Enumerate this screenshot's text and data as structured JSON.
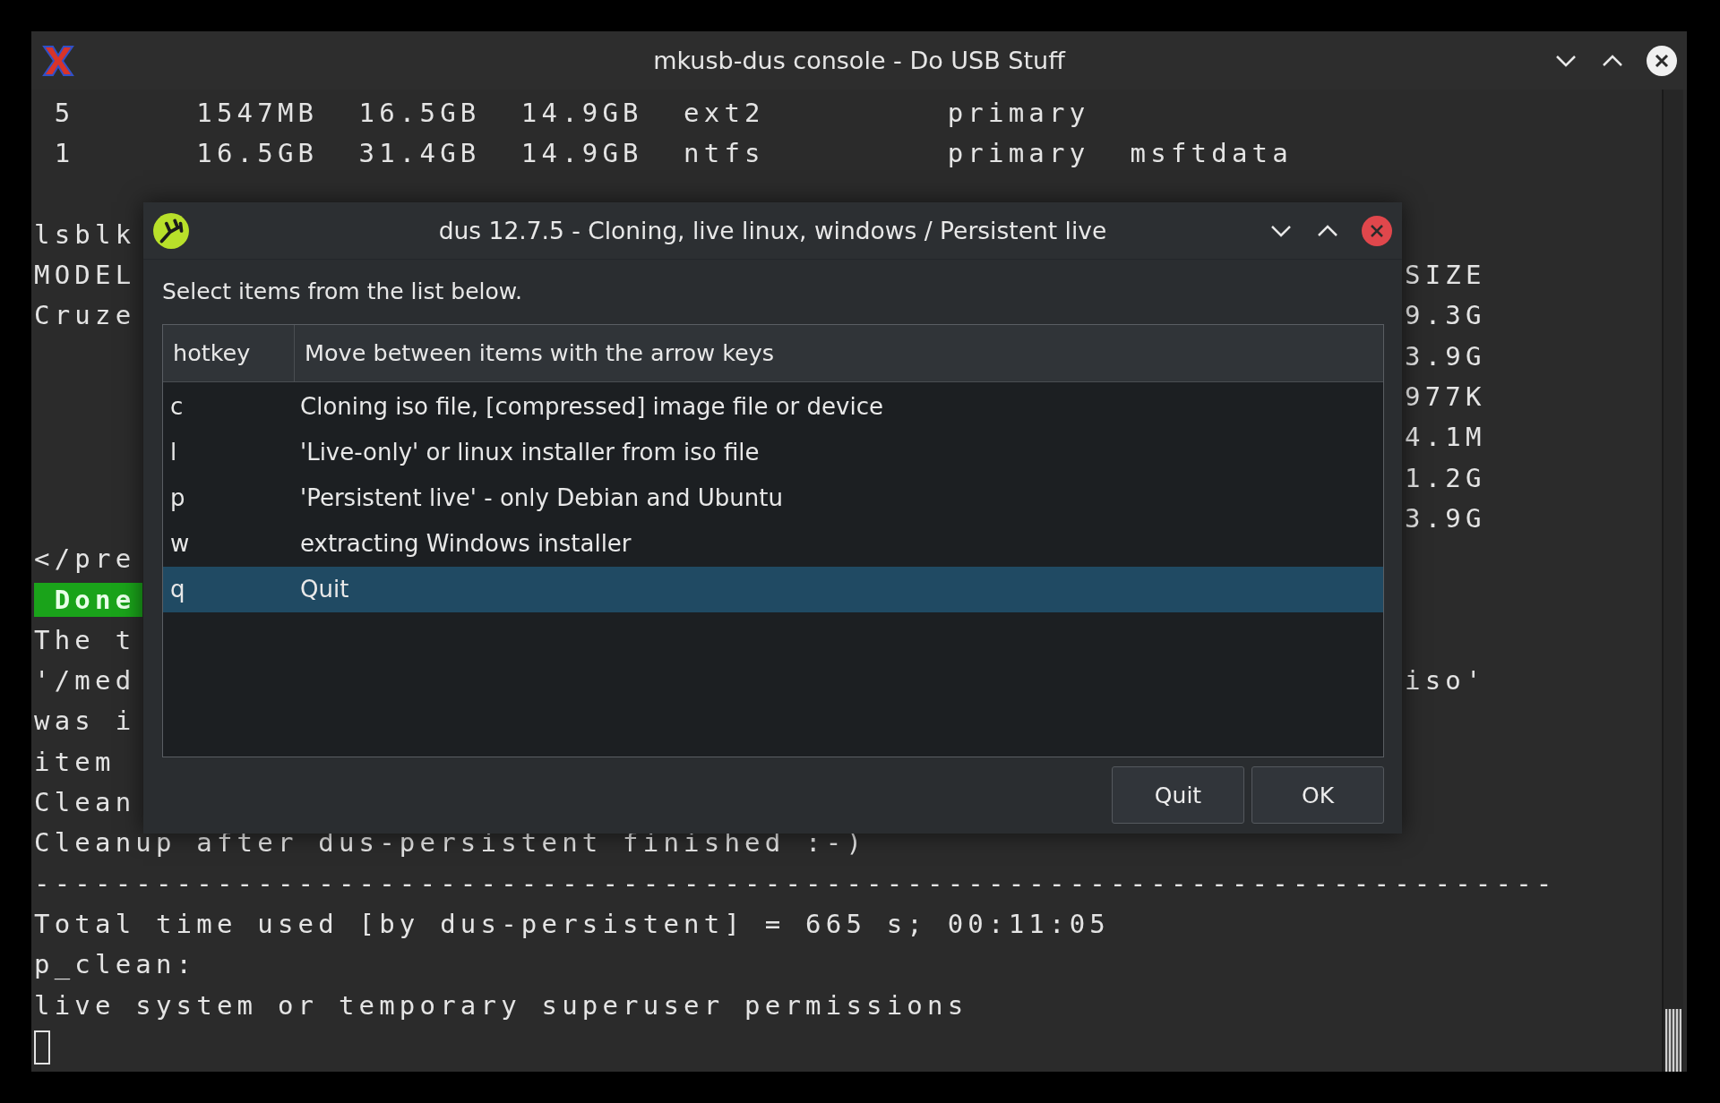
{
  "terminal": {
    "title": "mkusb-dus console - Do USB Stuff",
    "lines": [
      {
        "kind": "text",
        "text": " 5      1547MB  16.5GB  14.9GB  ext2         primary"
      },
      {
        "kind": "text",
        "text": " 1      16.5GB  31.4GB  14.9GB  ntfs         primary  msftdata"
      },
      {
        "kind": "blank"
      },
      {
        "kind": "text",
        "text": "lsblk"
      },
      {
        "kind": "text",
        "text": "MODEL",
        "right": "SIZE"
      },
      {
        "kind": "text",
        "text": "Cruze",
        "right": "9.3G"
      },
      {
        "kind": "text",
        "right": "3.9G"
      },
      {
        "kind": "text",
        "right": "977K"
      },
      {
        "kind": "text",
        "right": "4.1M"
      },
      {
        "kind": "text",
        "right": "1.2G"
      },
      {
        "kind": "text",
        "right": "3.9G"
      },
      {
        "kind": "text",
        "text": "</pre"
      },
      {
        "kind": "highlight",
        "text": " Done"
      },
      {
        "kind": "text",
        "text": "The t"
      },
      {
        "kind": "text",
        "text": "'/med",
        "right": "iso'"
      },
      {
        "kind": "text",
        "text": "was i"
      },
      {
        "kind": "text",
        "text": "item"
      },
      {
        "kind": "text",
        "text": "Clean"
      },
      {
        "kind": "text",
        "text": "Cleanup after dus-persistent finished :-)"
      },
      {
        "kind": "text",
        "text": "---------------------------------------------------------------------------"
      },
      {
        "kind": "text",
        "text": "Total time used [by dus-persistent] = 665 s; 00:11:05"
      },
      {
        "kind": "text",
        "text": "p_clean:"
      },
      {
        "kind": "text",
        "text": "live system or temporary superuser permissions"
      },
      {
        "kind": "cursor"
      }
    ]
  },
  "dialog": {
    "title": "dus 12.7.5 - Cloning, live linux, windows / Persistent live",
    "prompt": "Select items from the list below.",
    "table": {
      "columns": [
        "hotkey",
        "Move between items with the arrow keys"
      ],
      "rows": [
        {
          "hotkey": "c",
          "label": "Cloning iso file, [compressed] image file or device",
          "selected": false
        },
        {
          "hotkey": "l",
          "label": "'Live-only' or linux installer from iso file",
          "selected": false
        },
        {
          "hotkey": "p",
          "label": "'Persistent live' - only Debian and Ubuntu",
          "selected": false
        },
        {
          "hotkey": "w",
          "label": "extracting Windows installer",
          "selected": false
        },
        {
          "hotkey": "q",
          "label": "Quit",
          "selected": true
        }
      ]
    },
    "buttons": [
      "Quit",
      "OK"
    ]
  }
}
